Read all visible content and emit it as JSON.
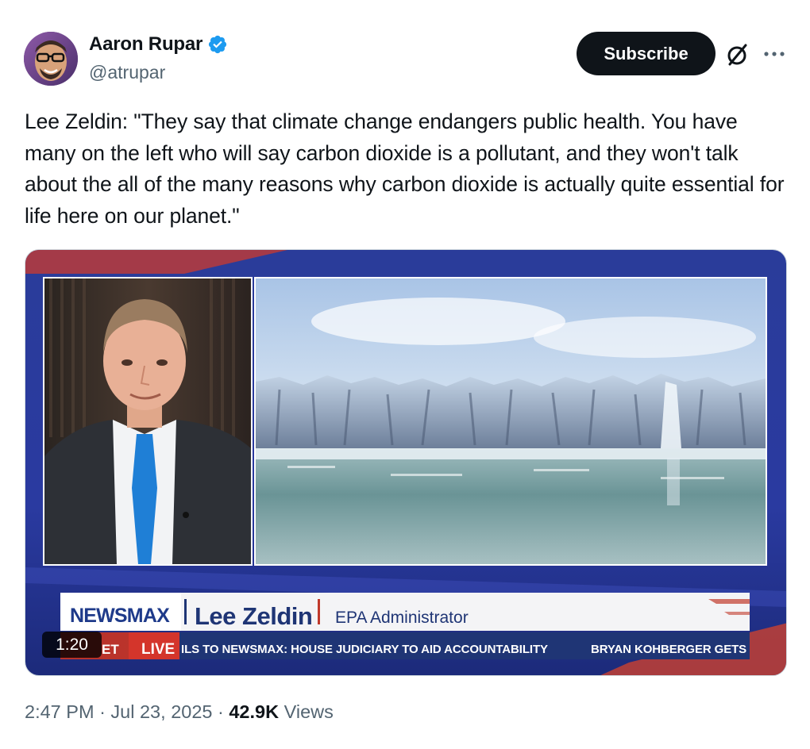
{
  "author": {
    "display_name": "Aaron Rupar",
    "handle": "@atrupar",
    "verified": true
  },
  "actions": {
    "subscribe_label": "Subscribe",
    "grok_icon": "grok-slash-circle-icon",
    "more_icon": "more-dots-icon"
  },
  "tweet": {
    "text": "Lee Zeldin: \"They say that climate change endangers public health. You have many on the left who will say carbon dioxide is a pollutant, and they won't talk about the all of the many reasons why carbon dioxide is actually quite essential for life here on our planet.\""
  },
  "video": {
    "duration": "1:20",
    "lower_third": {
      "network": "NEWSMAX",
      "name": "Lee Zeldin",
      "title": "EPA Administrator",
      "time_suffix": "ET",
      "live_label": "LIVE",
      "ticker_1": "ILS TO NEWSMAX: HOUSE JUDICIARY TO AID ACCOUNTABILITY",
      "ticker_2": "BRYAN KOHBERGER GETS"
    }
  },
  "footer": {
    "time": "2:47 PM",
    "date": "Jul 23, 2025",
    "views_count": "42.9K",
    "views_label": "Views"
  },
  "colors": {
    "verified_blue": "#1d9bf0",
    "text_primary": "#0f1419",
    "text_secondary": "#536471",
    "newsmax_blue": "#1f3575",
    "newsmax_red": "#c0392b"
  }
}
